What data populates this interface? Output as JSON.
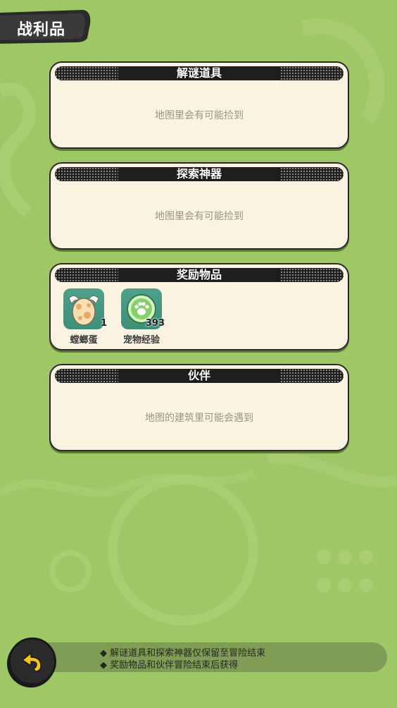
{
  "header": {
    "title": "战利品"
  },
  "panels": [
    {
      "title": "解谜道具",
      "empty_text": "地图里会有可能捡到"
    },
    {
      "title": "探索神器",
      "empty_text": "地图里会有可能捡到"
    },
    {
      "title": "奖励物品",
      "items": [
        {
          "name": "螳螂蛋",
          "count": "1",
          "icon": "winged-egg-icon"
        },
        {
          "name": "宠物经验",
          "count": "393",
          "icon": "paw-badge-icon"
        }
      ]
    },
    {
      "title": "伙伴",
      "empty_text": "地图的建筑里可能会遇到"
    }
  ],
  "footer": {
    "notes": [
      "◆ 解谜道具和探索神器仅保留至冒险结束",
      "◆ 奖励物品和伙伴冒险结束后获得"
    ],
    "back_icon": "back-arrow-icon"
  },
  "colors": {
    "background": "#9ec765",
    "panel": "#fbf3e2",
    "header_bar": "#1e1e1e",
    "item_tile": "#4fa18a"
  }
}
